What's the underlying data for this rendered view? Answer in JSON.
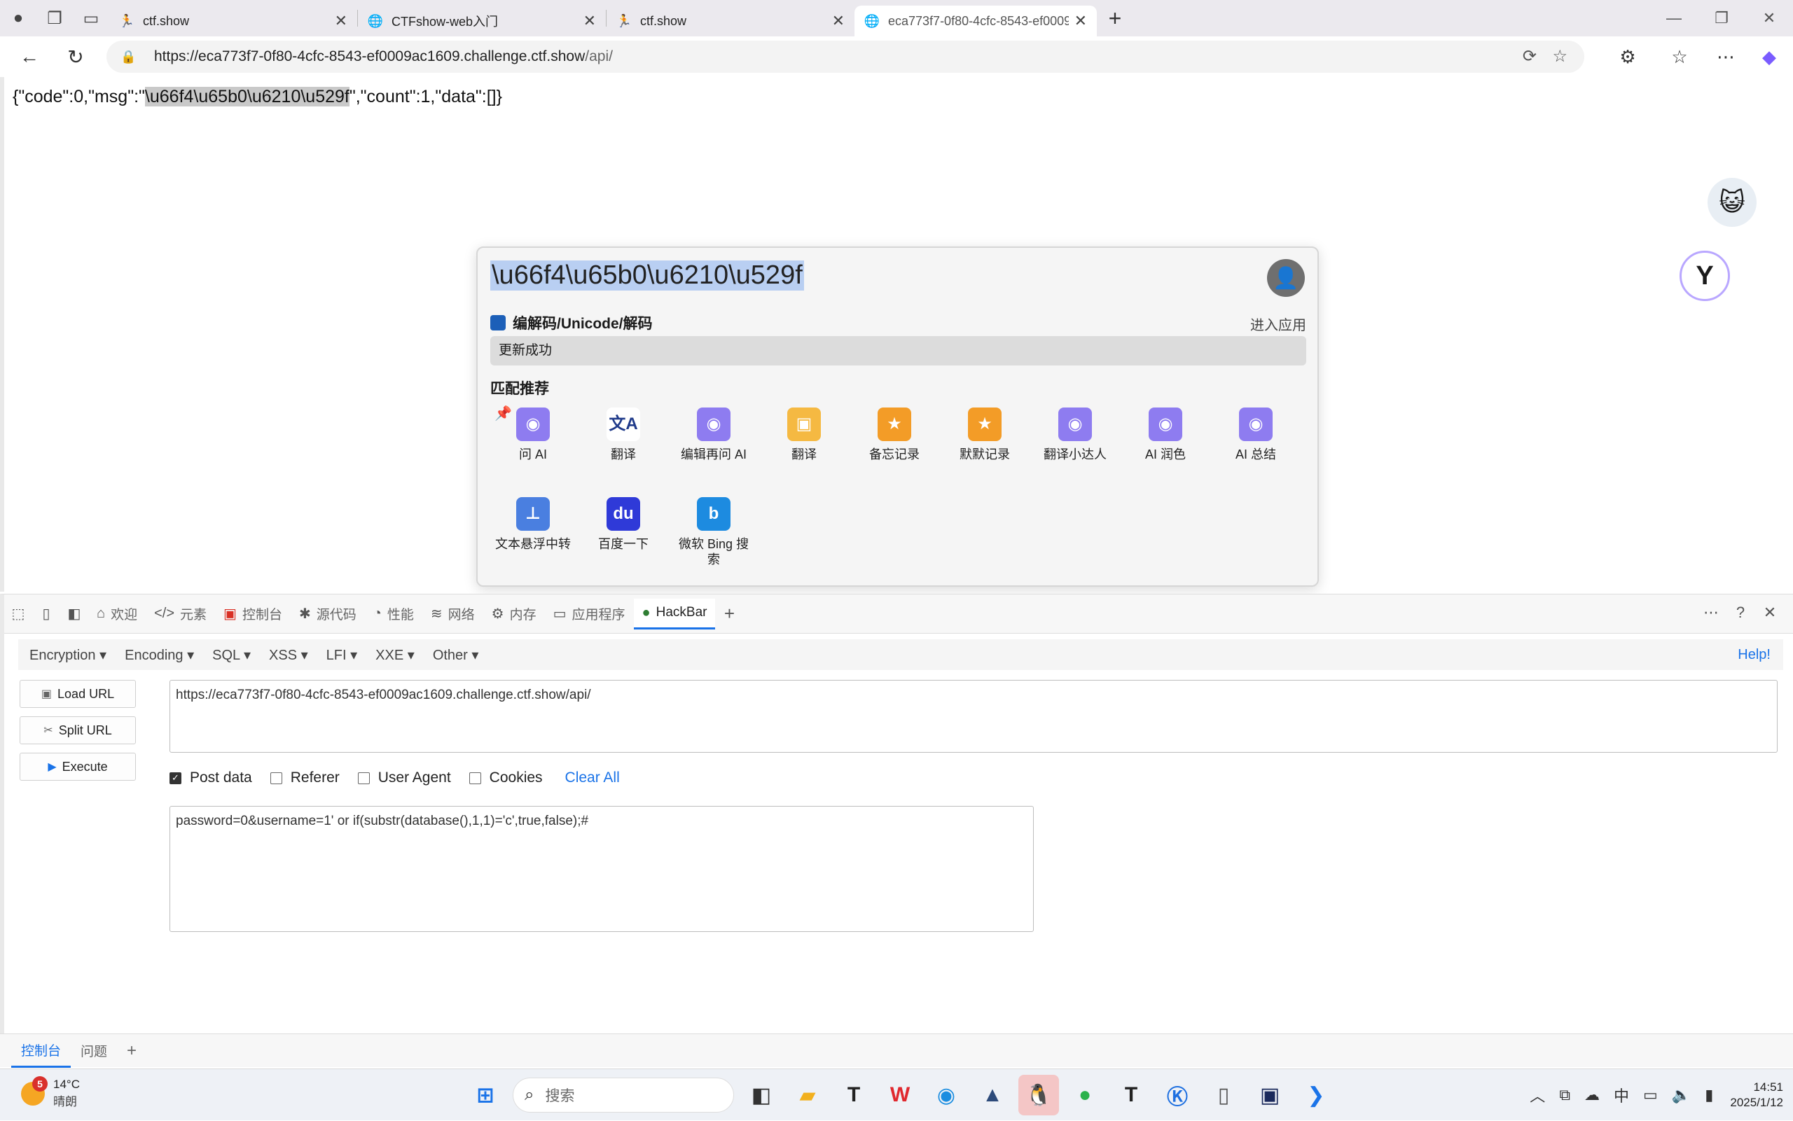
{
  "browser": {
    "tabs": [
      {
        "title": "ctf.show",
        "favicon": "runner-icon",
        "active": false
      },
      {
        "title": "CTFshow-web入门",
        "favicon": "globe-icon",
        "active": false
      },
      {
        "title": "ctf.show",
        "favicon": "runner-icon",
        "active": false
      },
      {
        "title": "eca773f7-0f80-4cfc-8543-ef0009a",
        "favicon": "globe-icon",
        "active": true
      }
    ],
    "url_host": "https://eca773f7-0f80-4cfc-8543-ef0009ac1609.challenge.ctf.show",
    "url_path": "/api/"
  },
  "page": {
    "json_prefix": "{\"code\":0,\"msg\":\"",
    "json_highlight": "\\u66f4\\u65b0\\u6210\\u529f",
    "json_suffix": "\",\"count\":1,\"data\":[]}"
  },
  "popup": {
    "selected_text": "\\u66f4\\u65b0\\u6210\\u529f",
    "tool_name": "编解码/Unicode/解码",
    "enter_app": "进入应用",
    "status": "更新成功",
    "section": "匹配推荐",
    "apps": [
      {
        "label": "问 AI",
        "icon": "robot-icon",
        "color": "#8e7cf0",
        "glyph": "◉"
      },
      {
        "label": "翻译",
        "icon": "translate-icon",
        "color": "#ffffff",
        "glyph": "文A"
      },
      {
        "label": "编辑再问 AI",
        "icon": "robot-icon",
        "color": "#8e7cf0",
        "glyph": "◉"
      },
      {
        "label": "翻译",
        "icon": "doc-translate-icon",
        "color": "#f5b942",
        "glyph": "▣"
      },
      {
        "label": "备忘记录",
        "icon": "star-note-icon",
        "color": "#f39c27",
        "glyph": "★"
      },
      {
        "label": "默默记录",
        "icon": "star-note-icon",
        "color": "#f39c27",
        "glyph": "★"
      },
      {
        "label": "翻译小达人",
        "icon": "robot-icon",
        "color": "#8e7cf0",
        "glyph": "◉"
      },
      {
        "label": "AI 润色",
        "icon": "robot-icon",
        "color": "#8e7cf0",
        "glyph": "◉"
      },
      {
        "label": "AI 总结",
        "icon": "robot-icon",
        "color": "#8e7cf0",
        "glyph": "◉"
      },
      {
        "label": "文本悬浮中转",
        "icon": "pin-icon",
        "color": "#4a7fe0",
        "glyph": "⊥"
      },
      {
        "label": "百度一下",
        "icon": "baidu-icon",
        "color": "#2f3ad8",
        "glyph": "du"
      },
      {
        "label": "微软 Bing 搜索",
        "icon": "bing-icon",
        "color": "#1d8be0",
        "glyph": "b"
      }
    ]
  },
  "devtools": {
    "tabs": [
      "欢迎",
      "元素",
      "控制台",
      "源代码",
      "性能",
      "网络",
      "内存",
      "应用程序",
      "HackBar"
    ],
    "hackbar": {
      "menus": [
        "Encryption",
        "Encoding",
        "SQL",
        "XSS",
        "LFI",
        "XXE",
        "Other"
      ],
      "help": "Help!",
      "load_url": "Load URL",
      "split_url": "Split URL",
      "execute": "Execute",
      "url_value": "https://eca773f7-0f80-4cfc-8543-ef0009ac1609.challenge.ctf.show/api/",
      "options": {
        "post_data": "Post data",
        "referer": "Referer",
        "user_agent": "User Agent",
        "cookies": "Cookies"
      },
      "post_data_checked": true,
      "clear_all": "Clear All",
      "post_value": "password=0&username=1' or if(substr(database(),1,1)='c',true,false);#"
    },
    "drawer_tabs": [
      "控制台",
      "问题"
    ]
  },
  "taskbar": {
    "weather_temp": "14°C",
    "weather_desc": "晴朗",
    "weather_badge": "5",
    "search_placeholder": "搜索",
    "ime": "中",
    "time": "14:51",
    "date": "2025/1/12"
  }
}
